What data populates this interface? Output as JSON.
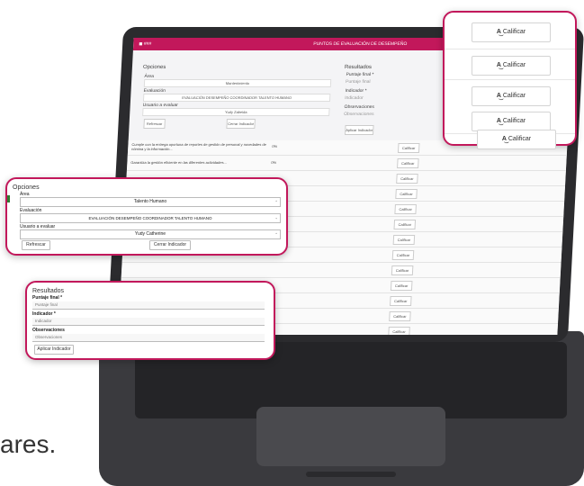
{
  "brand_color": "#c2185b",
  "screen": {
    "header_title": "PUNTOS DE EVALUACIÓN DE DESEMPEÑO",
    "header_left": "◼ ###",
    "opciones_title": "Opciones",
    "area_label": "Área",
    "area_value": "Mantenimiento",
    "evaluacion_label": "Evaluación",
    "evaluacion_value": "EVALUACIÓN DESEMPEÑO COORDINADOR TALENTO HUMANO",
    "usuario_label": "Usuario a evaluar",
    "usuario_value": "Yudy Zabeida",
    "refrescar": "Refrescar",
    "cerrar_indicador": "Cerrar Indicador",
    "resultados_title": "Resultados",
    "puntaje_label": "Puntaje final *",
    "puntaje_ph": "Puntaje final",
    "indicador_label": "Indicador *",
    "indicador_ph": "Indicador",
    "obs_label": "Observaciones",
    "obs_ph": "Observaciones",
    "aplicar": "Aplicar Indicador",
    "row1_text": "Cumple con la entrega oportuna de reportes de gestión de personal y novedades de nómina y la información...",
    "row2_text": "Garantiza la gestión eficiente en las diferentes actividades...",
    "row_cal": "Calificar",
    "row_value": "0%"
  },
  "opciones_card": {
    "title": "Opciones",
    "area_label": "Área",
    "area_value": "Talento Humano",
    "evaluacion_label": "Evaluación",
    "evaluacion_value": "EVALUACIÓN DESEMPEÑO COORDINADOR TALENTO HUMANO",
    "usuario_label": "Usuario a evaluar",
    "usuario_value": "Yudy Catherine",
    "refrescar": "Refrescar",
    "cerrar": "Cerrar Indicador"
  },
  "resultados_card": {
    "title": "Resultados",
    "puntaje_label": "Puntaje final *",
    "puntaje_ph": "Puntaje final",
    "indicador_label": "Indicador *",
    "indicador_ph": "Indicador",
    "obs_label": "Observaciones",
    "obs_ph": "Observaciones",
    "aplicar": "Aplicar Indicador"
  },
  "calificar_card": {
    "buttons": [
      "Calificar",
      "Calificar",
      "Calificar",
      "Calificar",
      "Calificar"
    ]
  },
  "caption": "ares."
}
